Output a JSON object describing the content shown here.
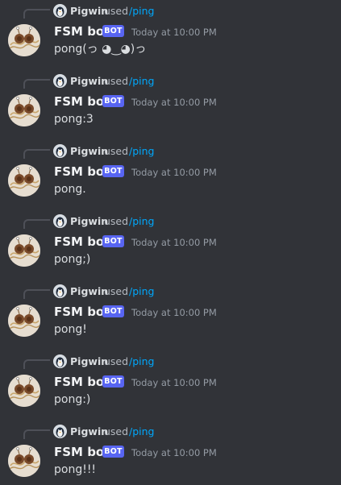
{
  "colors": {
    "background": "#313338",
    "link": "#00a8fc",
    "bot_badge": "#5865f2",
    "timestamp": "#949ba4",
    "author": "#f2f3f5"
  },
  "icons": {
    "command_user_avatar": "penguin-avatar-icon",
    "bot_avatar": "flying-spaghetti-monster-avatar"
  },
  "messages": [
    {
      "command_user": "Pigwin",
      "used_label": "used",
      "command": "/ping",
      "author": "FSM bot",
      "badge": "BOT",
      "timestamp": "Today at 10:00 PM",
      "content": "pong(っ ◕‿◕)っ"
    },
    {
      "command_user": "Pigwin",
      "used_label": "used",
      "command": "/ping",
      "author": "FSM bot",
      "badge": "BOT",
      "timestamp": "Today at 10:00 PM",
      "content": "pong:3"
    },
    {
      "command_user": "Pigwin",
      "used_label": "used",
      "command": "/ping",
      "author": "FSM bot",
      "badge": "BOT",
      "timestamp": "Today at 10:00 PM",
      "content": "pong."
    },
    {
      "command_user": "Pigwin",
      "used_label": "used",
      "command": "/ping",
      "author": "FSM bot",
      "badge": "BOT",
      "timestamp": "Today at 10:00 PM",
      "content": "pong;)"
    },
    {
      "command_user": "Pigwin",
      "used_label": "used",
      "command": "/ping",
      "author": "FSM bot",
      "badge": "BOT",
      "timestamp": "Today at 10:00 PM",
      "content": "pong!"
    },
    {
      "command_user": "Pigwin",
      "used_label": "used",
      "command": "/ping",
      "author": "FSM bot",
      "badge": "BOT",
      "timestamp": "Today at 10:00 PM",
      "content": "pong:)"
    },
    {
      "command_user": "Pigwin",
      "used_label": "used",
      "command": "/ping",
      "author": "FSM bot",
      "badge": "BOT",
      "timestamp": "Today at 10:00 PM",
      "content": "pong!!!"
    }
  ]
}
